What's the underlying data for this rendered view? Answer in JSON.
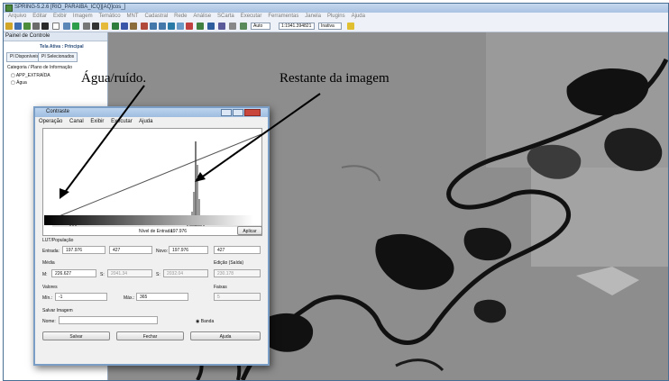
{
  "app": {
    "title": "SPRING-5.2.6 [RIO_PARAIBA_ICQ][AQ]cos_]",
    "menu": [
      "Arquivo",
      "Editar",
      "Exibir",
      "Imagem",
      "Temático",
      "MNT",
      "Cadastral",
      "Rede",
      "Análise",
      "SCarta",
      "Executar",
      "Ferramentas",
      "Janela",
      "Plugins",
      "Ajuda"
    ],
    "toolbar": {
      "zoom_value": "Auto",
      "scale_value": "1:1941.394821",
      "mode_value": "Inativa"
    }
  },
  "panel": {
    "title": "Painel de Controle",
    "screen_label": "Tela Ativa : Principal",
    "tab_available": "PI Disponíveis",
    "tab_selected": "PI Selecionados",
    "category_label": "Categoria / Plano de Informação",
    "layer_1": "APP_EXTRAÍDA",
    "layer_2": "Água"
  },
  "dialog": {
    "title": "Contraste",
    "menu": [
      "Operação",
      "Canal",
      "Exibir",
      "Executar",
      "Ajuda"
    ],
    "input_level_label": "Nível de Entrada:",
    "input_level_value": "197.976",
    "apply_label": "Aplicar",
    "lut_label": "LUT/População",
    "entrada_label": "Entrada:",
    "entrada_value": "197.976",
    "entrada_count": "427",
    "novo_label": "Novo:",
    "novo_value": "197.976",
    "novo_count": "427",
    "media_label": "Média",
    "edicao_label": "Edição (Saída)",
    "m_label": "M:",
    "m_value": "226.627",
    "s_label": "S:",
    "s_value": "2041.34",
    "s2_label": "S:",
    "s2_value": "2032.04",
    "edicao_value": "230.178",
    "valores_label": "Valores",
    "faixas_label": "Faixas",
    "min_label": "Mín.:",
    "min_value": "-1",
    "max_label": "Máx.:",
    "max_value": "365",
    "faixas_value": "5",
    "salvar_label": "Salvar Imagem",
    "nome_label": "Nome:",
    "nome_value": "",
    "banda_label": "Banda",
    "btn_salvar": "Salvar",
    "btn_fechar": "Fechar",
    "btn_ajuda": "Ajuda"
  },
  "annotations": {
    "water_noise": "Água/ruído.",
    "rest_of_image": "Restante da imagem"
  },
  "colors": {
    "titlebar": "#a9c3e2",
    "map_background": "#8d8d8d",
    "water_dark": "#111111",
    "close_red": "#c9463d"
  }
}
